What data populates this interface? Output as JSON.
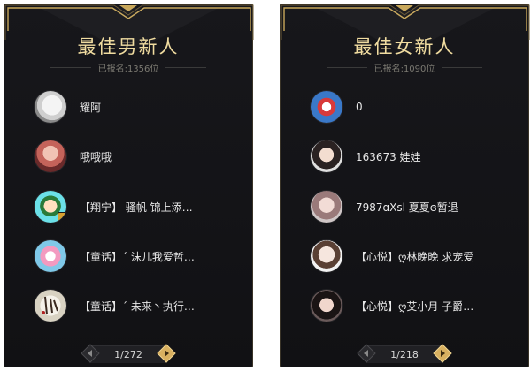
{
  "panels": [
    {
      "title": "最佳男新人",
      "signup": "已报名:1356位",
      "items": [
        {
          "name": "耀阿",
          "avatar": "avatar-white-pet"
        },
        {
          "name": "哦哦哦",
          "avatar": "avatar-girl-pink"
        },
        {
          "name": "【翔宁】 骚帆 锦上添…",
          "avatar": "avatar-cartoon-boy"
        },
        {
          "name": "【童话】´ 沫儿我爱哲…",
          "avatar": "avatar-cartoon-pink"
        },
        {
          "name": "【童话】´ 未来丶执行…",
          "avatar": "avatar-calligraphy"
        }
      ],
      "pager": {
        "text": "1/272"
      }
    },
    {
      "title": "最佳女新人",
      "signup": "已报名:1090位",
      "items": [
        {
          "name": "0",
          "avatar": "avatar-cartoon-character"
        },
        {
          "name": "163673 娃娃",
          "avatar": "avatar-girl-dark"
        },
        {
          "name": "7987ɑXsl 夏夏ɞ暂退",
          "avatar": "avatar-girl-light"
        },
        {
          "name": "【心悦】ღ林晚晚 求宠爱",
          "avatar": "avatar-girl-bright"
        },
        {
          "name": "【心悦】ღ艾小月 子爵…",
          "avatar": "avatar-girl-black-hair"
        }
      ],
      "pager": {
        "text": "1/218"
      }
    }
  ],
  "colors": {
    "panel_bg": "#141417",
    "gold": "#c9a85a",
    "title": "#f0dca0",
    "text": "#e8e8e8",
    "muted": "#7c7a72"
  }
}
